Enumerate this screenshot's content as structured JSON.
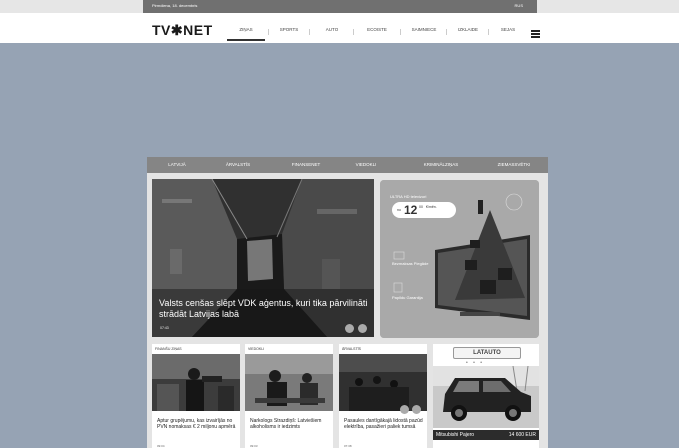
{
  "topbar": {
    "date": "Pirmdiena, 18. decembris",
    "lang": "RUS"
  },
  "header": {
    "logo": "TV✱NET",
    "nav": [
      "ZIŅAS",
      "SPORTS",
      "AUTO",
      "ECOISTE",
      "SAIMNIECE",
      "IZKLAIDE",
      "SEJAS"
    ]
  },
  "categories": [
    "LATVIJĀ",
    "ĀRVALSTĪS",
    "FINANSENET",
    "VIEDOKLI",
    "KRIMINĀLZIŅAS",
    "ZIEMASSVĒTKI"
  ],
  "hero": {
    "title": "Valsts cenšas slēpt VDK aģentus, kuri tika pārvilināti strādāt Latvijas labā",
    "time": "07:43"
  },
  "ad_tv": {
    "headline": "ULTRA HD televizori",
    "price_prefix": "no",
    "price_big": "12",
    "price_cents": "00",
    "price_unit": "€/mēn.",
    "row1": "Bezmaksas Piegāde",
    "row2": "Papildu Garantija"
  },
  "cards": [
    {
      "category": "FINANŠU ZIŅAS",
      "title": "Aptur grupējumu, kas izvairījās no PVN nomaksas € 2 miljonu apmērā",
      "time": "09:04"
    },
    {
      "category": "VIEDOKLI",
      "title": "Narkologs Strazdiņš: Latviešiem alkoholisms ir iedzimts",
      "time": "09:03"
    },
    {
      "category": "ĀRVALSTĪS",
      "title": "Pasaules dantīgākajā lidostā pazūd elektrība, pasažieri paliek tumsā",
      "time": "07:38"
    }
  ],
  "ad_car": {
    "brand": "LATAUTO",
    "model": "Mitsubishi Pajero",
    "price": "14 600 EUR"
  },
  "colors": {
    "page_bg": "#96a3b4",
    "topbar": "#707070",
    "catbar": "#858585"
  }
}
